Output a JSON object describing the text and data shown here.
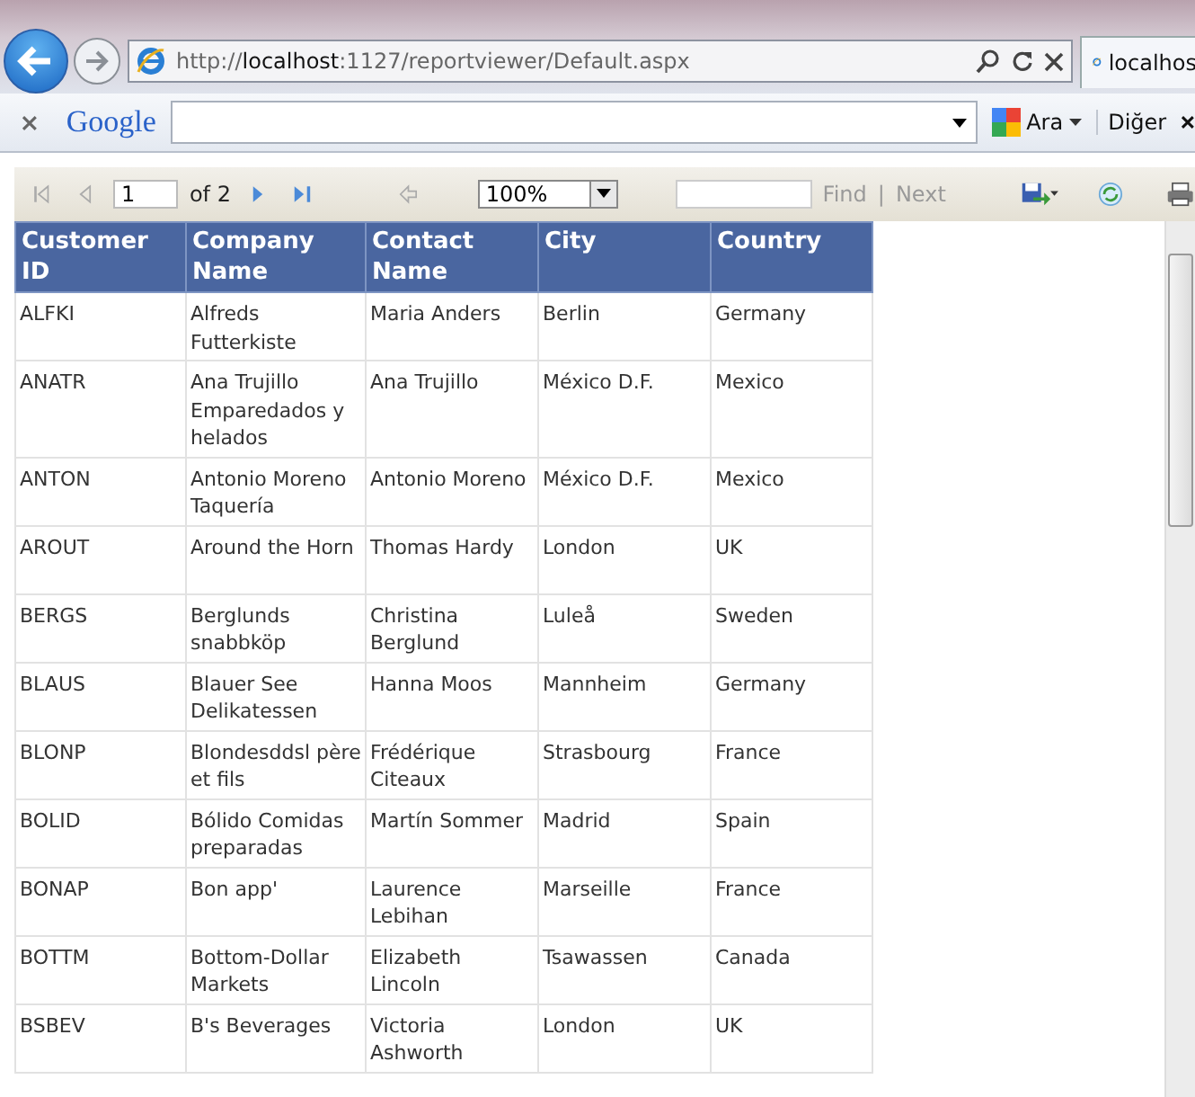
{
  "browser": {
    "url_prefix": "http://",
    "url_host": "localhost",
    "url_rest": ":1127/reportviewer/Default.aspx",
    "tab_title": "localhos"
  },
  "google_toolbar": {
    "logo": "Google",
    "search_button": "Ara",
    "more": "Diğer"
  },
  "report_toolbar": {
    "page": "1",
    "page_of": "of 2",
    "zoom": "100%",
    "find": "Find",
    "separator": "|",
    "next": "Next"
  },
  "table": {
    "columns": [
      "Customer ID",
      "Company Name",
      "Contact Name",
      "City",
      "Country"
    ],
    "rows": [
      [
        "ALFKI",
        "Alfreds Futterkiste",
        "Maria Anders",
        "Berlin",
        "Germany"
      ],
      [
        "ANATR",
        "Ana Trujillo Emparedados y helados",
        "Ana Trujillo",
        "México D.F.",
        "Mexico"
      ],
      [
        "ANTON",
        "Antonio Moreno Taquería",
        "Antonio Moreno",
        "México D.F.",
        "Mexico"
      ],
      [
        "AROUT",
        "Around the Horn",
        "Thomas Hardy",
        "London",
        "UK"
      ],
      [
        "BERGS",
        "Berglunds snabbköp",
        "Christina Berglund",
        "Luleå",
        "Sweden"
      ],
      [
        "BLAUS",
        "Blauer See Delikatessen",
        "Hanna Moos",
        "Mannheim",
        "Germany"
      ],
      [
        "BLONP",
        "Blondesddsl père et fils",
        "Frédérique Citeaux",
        "Strasbourg",
        "France"
      ],
      [
        "BOLID",
        "Bólido Comidas preparadas",
        "Martín Sommer",
        "Madrid",
        "Spain"
      ],
      [
        "BONAP",
        "Bon app'",
        "Laurence Lebihan",
        "Marseille",
        "France"
      ],
      [
        "BOTTM",
        "Bottom-Dollar Markets",
        "Elizabeth Lincoln",
        "Tsawassen",
        "Canada"
      ],
      [
        "BSBEV",
        "B's Beverages",
        "Victoria Ashworth",
        "London",
        "UK"
      ]
    ]
  }
}
